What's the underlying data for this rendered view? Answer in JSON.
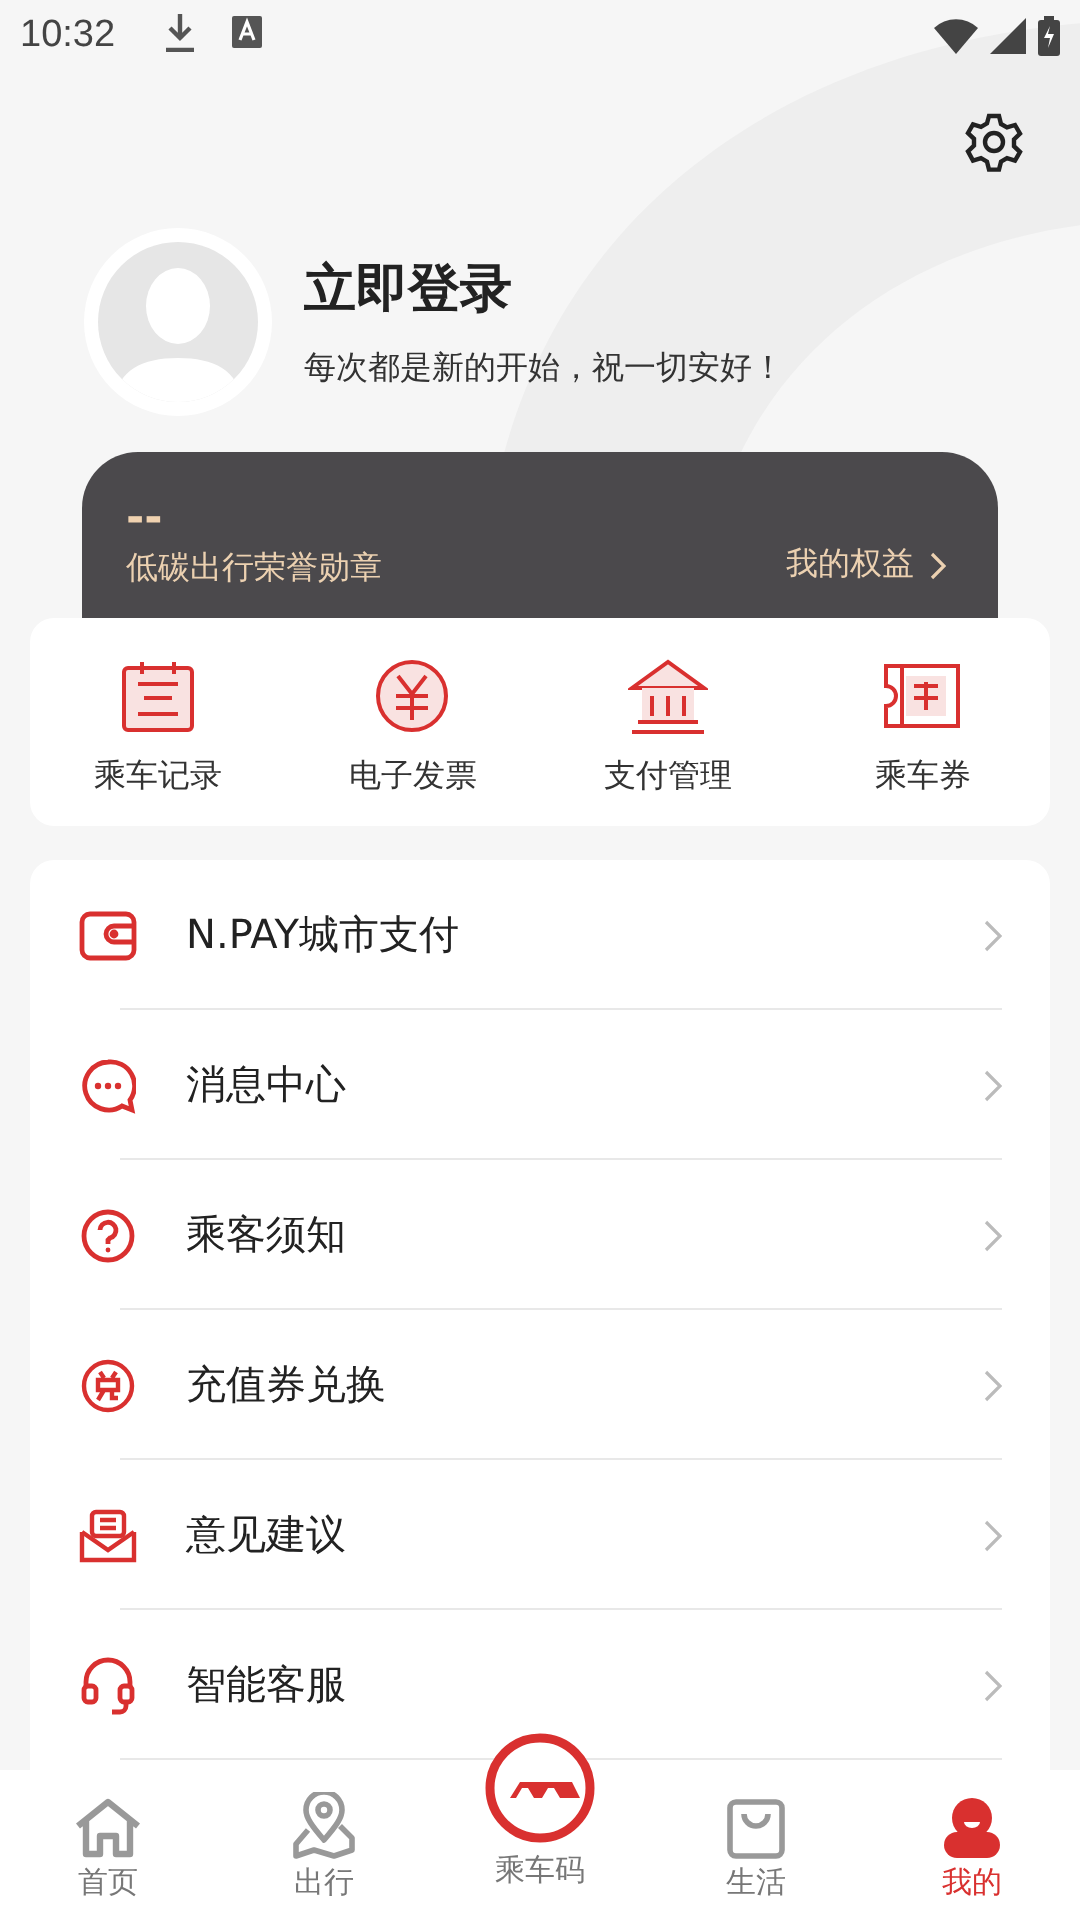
{
  "status_bar": {
    "time": "10:32"
  },
  "profile": {
    "title": "立即登录",
    "subtitle": "每次都是新的开始，祝一切安好！"
  },
  "badge_card": {
    "value": "--",
    "label": "低碳出行荣誉勋章",
    "link": "我的权益"
  },
  "shortcuts": [
    {
      "label": "乘车记录"
    },
    {
      "label": "电子发票"
    },
    {
      "label": "支付管理"
    },
    {
      "label": "乘车券"
    }
  ],
  "menu": [
    {
      "label": "N.PAY城市支付"
    },
    {
      "label": "消息中心"
    },
    {
      "label": "乘客须知"
    },
    {
      "label": "充值券兑换"
    },
    {
      "label": "意见建议"
    },
    {
      "label": "智能客服"
    }
  ],
  "tab_bar": [
    {
      "label": "首页",
      "selected": false
    },
    {
      "label": "出行",
      "selected": false
    },
    {
      "label": "乘车码",
      "selected": false
    },
    {
      "label": "生活",
      "selected": false
    },
    {
      "label": "我的",
      "selected": true
    }
  ]
}
